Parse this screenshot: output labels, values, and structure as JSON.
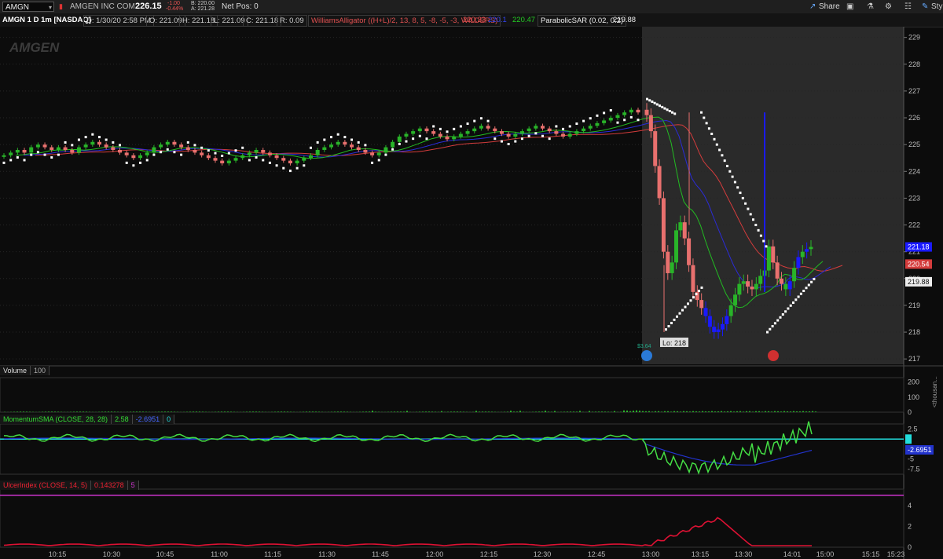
{
  "toolbar": {
    "symbol": "AMGN",
    "company": "AMGEN INC COM",
    "last": "226.15",
    "change": "-1.00",
    "change_pct": "-0.44%",
    "bid": "B: 220.00",
    "ask": "A: 221.28",
    "net_pos": "Net Pos: 0",
    "share_label": "Share",
    "style_label": "Styl"
  },
  "info": {
    "title": "AMGN 1 D 1m [NASDAQ]",
    "date": "D: 1/30/20 2:58 PM",
    "open": "O: 221.09",
    "high": "H: 221.18",
    "low": "L: 221.09",
    "close": "C: 221.18",
    "range": "R: 0.09",
    "alligator": "WilliamsAlligator ((H+L)/2, 13, 8, 5, -8, -5, -3, WILDERS)",
    "alligator_red": "220.23",
    "alligator_blue": "220.1",
    "alligator_green": "220.47",
    "sar": "ParabolicSAR (0.02, 0.2)",
    "sar_val": "219.88"
  },
  "colors": {
    "bg": "#0c0c0c",
    "session_bg": "#2a2a2a",
    "up": "#29b429",
    "down": "#e8706e",
    "blue_bar": "#1a1aff",
    "jaw": "#d43c3c",
    "teeth": "#2b2bd8",
    "lips": "#22bb22",
    "sar": "#ffffff",
    "momentum": "#44dd44",
    "momentum_sma": "#2233cc",
    "zero_line": "#22dddd",
    "ulcer": "#dd1133",
    "ulcer_level": "#cc33cc"
  },
  "watermark": "AMGEN",
  "labels": {
    "lo": "Lo: 218",
    "earnings_small": "$3.64",
    "volume_panel": "Volume",
    "volume_val": "100",
    "momentum_panel": "MomentumSMA (CLOSE, 28, 28)",
    "momentum_val": "2.58",
    "momentum_sma_val": "-2.6951",
    "momentum_zero": "0",
    "ulcer_panel": "UlcerIndex (CLOSE, 14, 5)",
    "ulcer_val": "0.143278",
    "ulcer_level": "5",
    "volume_unit": "<thousan..."
  },
  "chart_data": {
    "type": "candlestick",
    "price_axis": {
      "ylim": [
        216.8,
        229.4
      ],
      "ticks": [
        217,
        218,
        219,
        220,
        221,
        222,
        223,
        224,
        225,
        226,
        227,
        228,
        229
      ]
    },
    "price_markers": [
      {
        "value": "221.18",
        "color": "#1a1aff",
        "y": 221.18
      },
      {
        "value": "220.54",
        "color": "#d43c3c",
        "y": 220.54
      },
      {
        "value": "219.88",
        "color": "#ffffff",
        "y": 219.88
      }
    ],
    "time_axis": {
      "ticks": [
        "10:15",
        "10:30",
        "10:45",
        "11:00",
        "11:15",
        "11:30",
        "11:45",
        "12:00",
        "12:15",
        "12:30",
        "12:45",
        "13:00",
        "13:15",
        "13:30",
        "14:01",
        "15:00",
        "15:15",
        "15:23"
      ]
    },
    "volume_axis": {
      "ticks": [
        200,
        100,
        0
      ]
    },
    "momentum_axis": {
      "ticks": [
        "2.5",
        "0",
        "-2.5",
        "-5",
        "-7.5"
      ]
    },
    "ulcer_axis": {
      "ticks": [
        4,
        2,
        0
      ]
    },
    "close_series_pre": [
      224.6,
      224.7,
      224.8,
      224.7,
      224.9,
      225.0,
      224.9,
      224.8,
      224.9,
      224.8,
      224.7,
      224.9,
      225.0,
      225.1,
      225.0,
      224.9,
      224.8,
      224.7,
      224.6,
      224.5,
      224.6,
      224.7,
      224.9,
      225.0,
      225.1,
      225.0,
      224.9,
      224.8,
      224.7,
      224.6,
      224.5,
      224.4,
      224.3,
      224.4,
      224.5,
      224.6,
      224.7,
      224.8,
      224.7,
      224.6,
      224.5,
      224.4,
      224.3,
      224.4,
      224.5,
      224.6,
      224.8,
      224.9,
      225.0,
      225.1,
      225.0,
      224.9,
      224.8,
      224.7,
      224.6,
      224.7,
      224.9,
      225.1,
      225.3,
      225.4,
      225.5,
      225.6,
      225.5,
      225.4,
      225.3,
      225.2,
      225.3,
      225.4,
      225.5,
      225.6,
      225.7,
      225.6,
      225.5,
      225.4,
      225.3,
      225.4,
      225.5,
      225.6,
      225.7,
      225.6,
      225.5,
      225.4,
      225.3,
      225.4,
      225.5,
      225.6,
      225.7,
      225.8,
      225.9,
      226.0,
      226.1,
      226.2,
      226.3,
      226.2
    ],
    "close_series_post": [
      226.1,
      225.5,
      224.2,
      223.0,
      221.0,
      220.2,
      220.6,
      221.8,
      222.1,
      221.5,
      220.5,
      219.5,
      219.2,
      218.9,
      218.6,
      218.2,
      218.0,
      218.1,
      218.3,
      218.6,
      219.0,
      219.4,
      219.8,
      219.9,
      219.7,
      219.6,
      219.8,
      220.1,
      220.3,
      221.2,
      220.6,
      220.0,
      219.8,
      219.6,
      219.9,
      220.4,
      220.8,
      221.0,
      221.1,
      221.18
    ],
    "momentum": {
      "current": 2.58,
      "sma": -2.6951
    },
    "ulcer_index": {
      "current": 0.143278,
      "level": 5
    }
  }
}
